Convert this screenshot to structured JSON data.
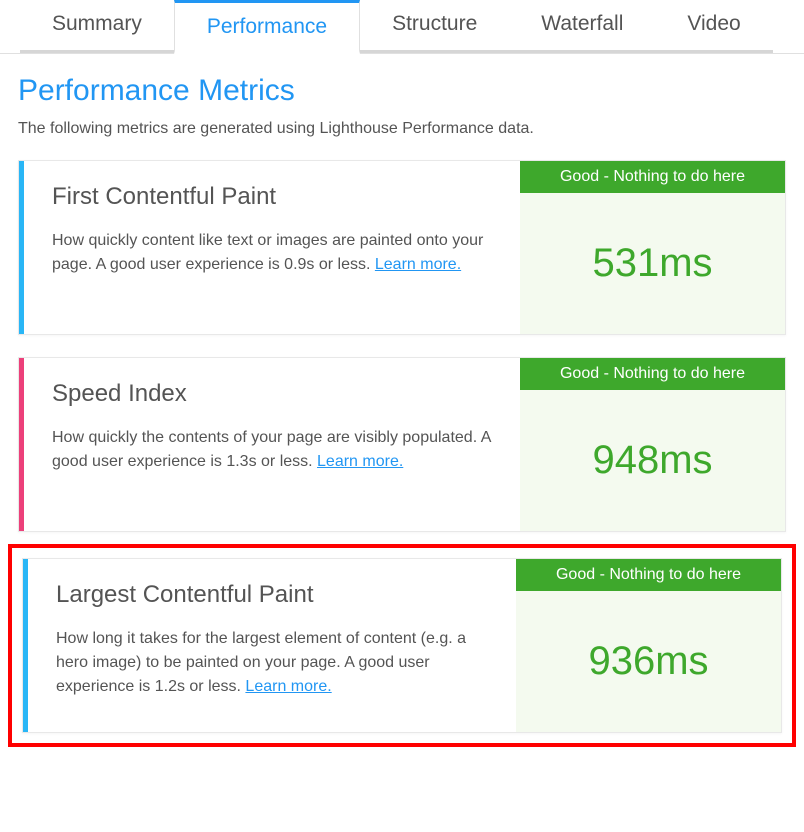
{
  "tabs": {
    "summary": "Summary",
    "performance": "Performance",
    "structure": "Structure",
    "waterfall": "Waterfall",
    "video": "Video"
  },
  "header": {
    "title": "Performance Metrics",
    "subtitle": "The following metrics are generated using Lighthouse Performance data."
  },
  "metrics": {
    "fcp": {
      "title": "First Contentful Paint",
      "desc": "How quickly content like text or images are painted onto your page. A good user experience is 0.9s or less. ",
      "learn": "Learn more.",
      "status": "Good - Nothing to do here",
      "value": "531ms"
    },
    "si": {
      "title": "Speed Index",
      "desc": "How quickly the contents of your page are visibly populated. A good user experience is 1.3s or less. ",
      "learn": "Learn more.",
      "status": "Good - Nothing to do here",
      "value": "948ms"
    },
    "lcp": {
      "title": "Largest Contentful Paint",
      "desc": "How long it takes for the largest element of content (e.g. a hero image) to be painted on your page. A good user experience is 1.2s or less. ",
      "learn": "Learn more.",
      "status": "Good - Nothing to do here",
      "value": "936ms"
    }
  }
}
